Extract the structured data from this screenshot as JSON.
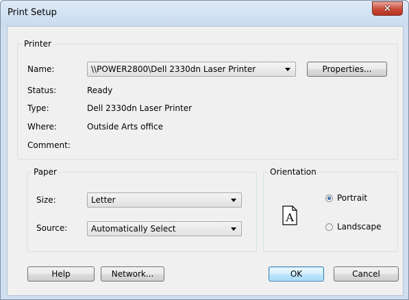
{
  "window": {
    "title": "Print Setup"
  },
  "printer": {
    "group_label": "Printer",
    "name_label": "Name:",
    "name_value": "\\\\POWER2800\\Dell 2330dn Laser Printer",
    "properties_label": "Properties...",
    "status_label": "Status:",
    "status_value": "Ready",
    "type_label": "Type:",
    "type_value": "Dell 2330dn Laser Printer",
    "where_label": "Where:",
    "where_value": "Outside Arts office",
    "comment_label": "Comment:",
    "comment_value": ""
  },
  "paper": {
    "group_label": "Paper",
    "size_label": "Size:",
    "size_value": "Letter",
    "source_label": "Source:",
    "source_value": "Automatically Select"
  },
  "orientation": {
    "group_label": "Orientation",
    "icon_letter": "A",
    "portrait_label": "Portrait",
    "landscape_label": "Landscape",
    "selected": "Portrait"
  },
  "buttons": {
    "help": "Help",
    "network": "Network...",
    "ok": "OK",
    "cancel": "Cancel"
  },
  "colors": {
    "window_frame": "#cfdff0",
    "close_button": "#c94a37",
    "default_button_border": "#3c7fb1"
  }
}
